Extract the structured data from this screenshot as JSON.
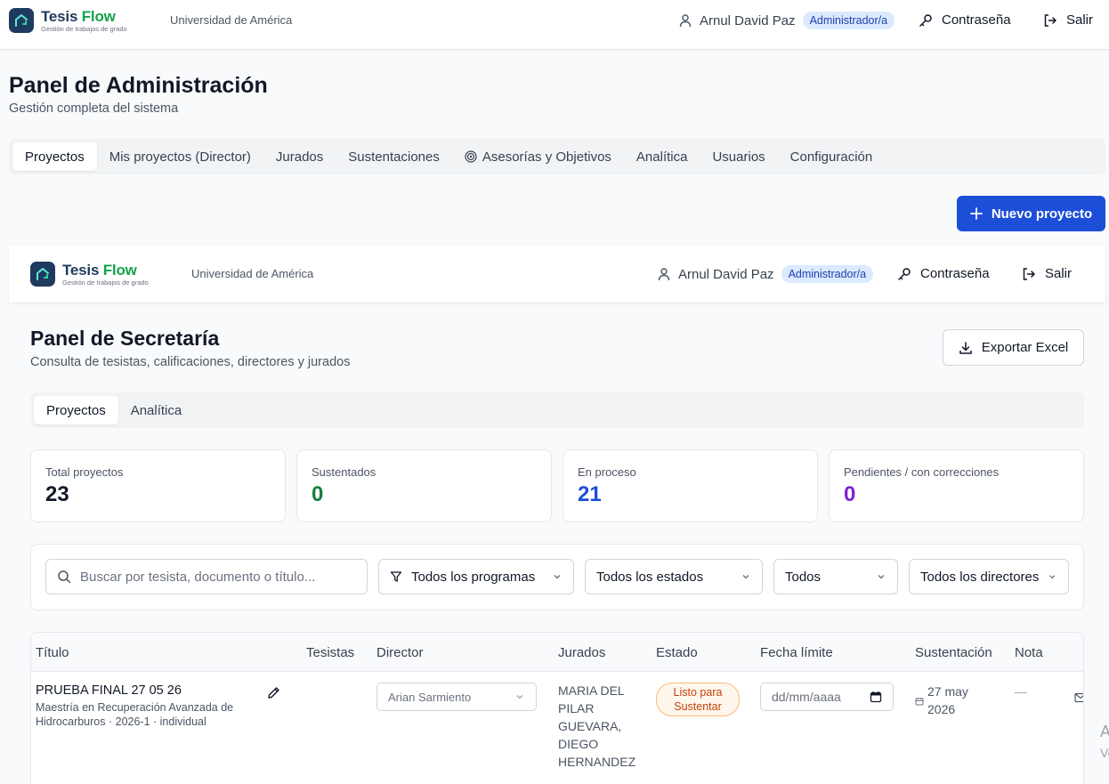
{
  "outer": {
    "brand": {
      "name_a": "Tesis",
      "name_b": "Flow",
      "subtitle": "Gestión de trabajos de grado"
    },
    "university": "Universidad de América",
    "user_name": "Arnul David Paz",
    "role": "Administrador/a",
    "password_label": "Contraseña",
    "logout_label": "Salir",
    "title": "Panel de Administración",
    "subtitle": "Gestión completa del sistema",
    "tabs": [
      "Proyectos",
      "Mis proyectos (Director)",
      "Jurados",
      "Sustentaciones",
      "Asesorías y Objetivos",
      "Analítica",
      "Usuarios",
      "Configuración"
    ],
    "new_project_label": "Nuevo proyecto"
  },
  "inner": {
    "brand": {
      "name_a": "Tesis",
      "name_b": "Flow",
      "subtitle": "Gestión de trabajos de grado"
    },
    "university": "Universidad de América",
    "user_name": "Arnul David Paz",
    "role": "Administrador/a",
    "password_label": "Contraseña",
    "logout_label": "Salir",
    "title": "Panel de Secretaría",
    "subtitle": "Consulta de tesistas, calificaciones, directores y jurados",
    "export_label": "Exportar Excel",
    "tabs": [
      "Proyectos",
      "Analítica"
    ],
    "stats": [
      {
        "label": "Total proyectos",
        "value": "23",
        "color": "#111827"
      },
      {
        "label": "Sustentados",
        "value": "0",
        "color": "#15803d"
      },
      {
        "label": "En proceso",
        "value": "21",
        "color": "#1d4ed8"
      },
      {
        "label": "Pendientes / con correcciones",
        "value": "0",
        "color": "#7e22ce"
      }
    ],
    "filters": {
      "search_placeholder": "Buscar por tesista, documento o título...",
      "program": "Todos los programas",
      "status": "Todos los estados",
      "all": "Todos",
      "directors": "Todos los directores"
    },
    "table": {
      "headers": [
        "Título",
        "Tesistas",
        "Director",
        "Jurados",
        "Estado",
        "Fecha límite",
        "Sustentación",
        "Nota"
      ],
      "rows": [
        {
          "title": "PRUEBA FINAL 27 05 26",
          "meta_line1": "Maestría en Recuperación Avanzada de",
          "meta_line2": "Hidrocarburos · 2026-1 · individual",
          "director": "Arian Sarmiento",
          "jurados": [
            "MARIA DEL",
            "PILAR",
            "GUEVARA,",
            "DIEGO",
            "HERNANDEZ"
          ],
          "status_line1": "Listo para",
          "status_line2": "Sustentar",
          "deadline_placeholder": "dd/mm/aaaa",
          "defense_line1": "27 may",
          "defense_line2": "2026",
          "grade": "—"
        }
      ]
    }
  },
  "watermark": {
    "line1": "A",
    "line2": "Ve"
  }
}
